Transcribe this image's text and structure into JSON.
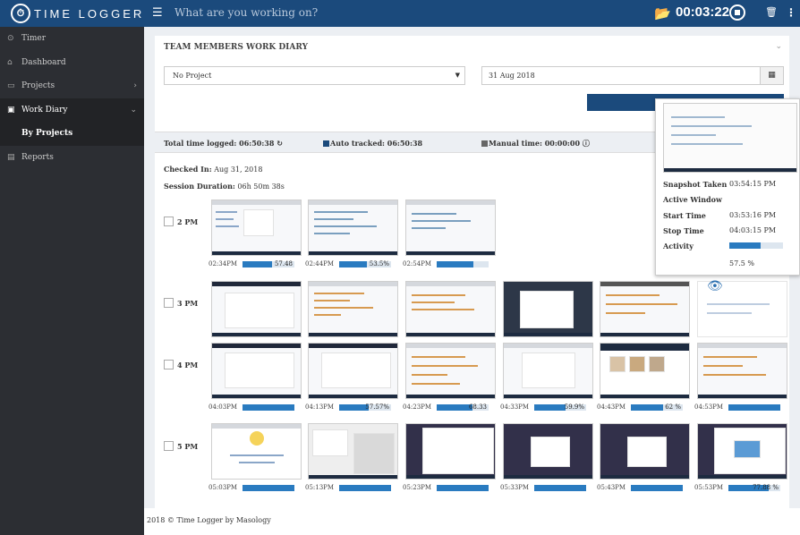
{
  "app": {
    "logo_mark": "⏱",
    "logo_text": "TIME LOGGER"
  },
  "header": {
    "search_placeholder": "What are you working on?",
    "timer": "00:03:22",
    "icons": [
      "menu-icon",
      "folder-icon",
      "stop-icon",
      "trash-icon",
      "kebab-icon"
    ]
  },
  "sidebar": {
    "items": [
      {
        "label": "Timer",
        "icon": "clock-icon"
      },
      {
        "label": "Dashboard",
        "icon": "home-icon"
      },
      {
        "label": "Projects",
        "icon": "folder-icon"
      },
      {
        "label": "Work Diary",
        "icon": "book-icon"
      },
      {
        "label": "By Projects",
        "icon": ""
      },
      {
        "label": "Reports",
        "icon": "report-icon"
      }
    ]
  },
  "diary": {
    "title": "TEAM MEMBERS WORK DIARY",
    "project_select": "No Project",
    "date": "31 Aug 2018",
    "total_time": "Total time logged: 06:50:38",
    "auto_tracked": "Auto tracked: 06:50:38",
    "manual_time": "Manual time: 00:00:00",
    "checked_in_label": "Checked In:",
    "checked_in_value": "Aug 31, 2018",
    "session_label": "Session Duration:",
    "session_value": "06h 50m 38s",
    "colors": {
      "primary": "#1b4a7c",
      "activity": "#2a7bc0"
    }
  },
  "hours": [
    {
      "label": "2 PM",
      "entries": [
        {
          "time": "02:34PM",
          "activity": 57.48,
          "label": "57.48"
        },
        {
          "time": "02:44PM",
          "activity": 53.5,
          "label": "53.5%"
        },
        {
          "time": "02:54PM",
          "activity": 70,
          "label": ""
        }
      ]
    },
    {
      "label": "3 PM",
      "entries": []
    },
    {
      "label": "4 PM",
      "entries": [
        {
          "time": "04:03PM",
          "activity": 100,
          "label": ""
        },
        {
          "time": "04:13PM",
          "activity": 57.57,
          "label": "57.57%"
        },
        {
          "time": "04:23PM",
          "activity": 68.33,
          "label": "68.33"
        },
        {
          "time": "04:33PM",
          "activity": 59.9,
          "label": "59.9%"
        },
        {
          "time": "04:43PM",
          "activity": 62,
          "label": "62 %"
        },
        {
          "time": "04:53PM",
          "activity": 100,
          "label": ""
        }
      ]
    },
    {
      "label": "5 PM",
      "entries": [
        {
          "time": "05:03PM",
          "activity": 100,
          "label": ""
        },
        {
          "time": "05:13PM",
          "activity": 100,
          "label": ""
        },
        {
          "time": "05:23PM",
          "activity": 100,
          "label": ""
        },
        {
          "time": "05:33PM",
          "activity": 100,
          "label": ""
        },
        {
          "time": "05:43PM",
          "activity": 100,
          "label": ""
        },
        {
          "time": "05:53PM",
          "activity": 77.88,
          "label": "77.88 %"
        }
      ]
    }
  ],
  "popup": {
    "snapshot_label": "Snapshot Taken",
    "snapshot_value": "03:54:15 PM",
    "window_label": "Active Window",
    "start_label": "Start Time",
    "start_value": "03:53:16 PM",
    "stop_label": "Stop Time",
    "stop_value": "04:03:15 PM",
    "activity_label": "Activity",
    "activity": 57.5,
    "activity_text": "57.5 %"
  },
  "footer": {
    "text": "2018 © Time Logger by Masology"
  }
}
